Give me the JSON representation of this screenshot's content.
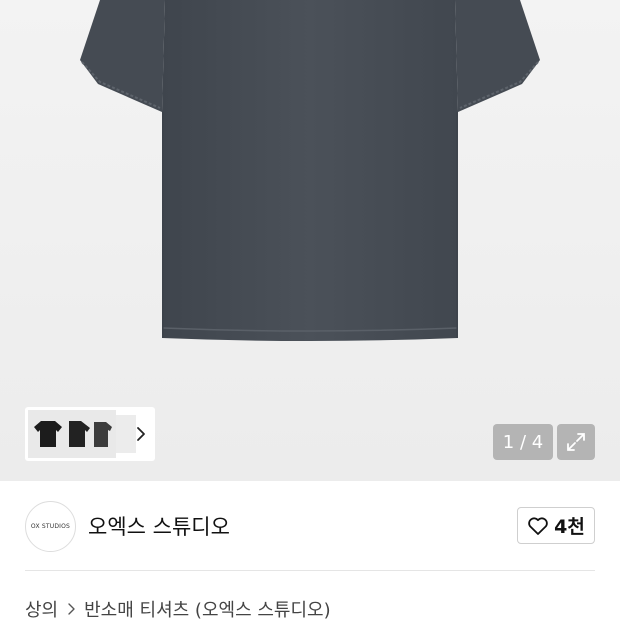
{
  "gallery": {
    "counter": "1 / 4",
    "icons": {
      "expand": "expand-arrows-icon",
      "next": "chevron-right-icon"
    }
  },
  "brand": {
    "logo_text": "OX STUDIOS",
    "name": "오엑스 스튜디오",
    "like_count": "4천",
    "like_icon": "heart-outline-icon"
  },
  "breadcrumb": {
    "category": "상의",
    "product": "반소매 티셔츠 (오엑스 스튜디오)"
  },
  "colors": {
    "shirt": "#4a5058",
    "overlay_button": "#b4b4b4",
    "background": "#f0f0f0"
  }
}
